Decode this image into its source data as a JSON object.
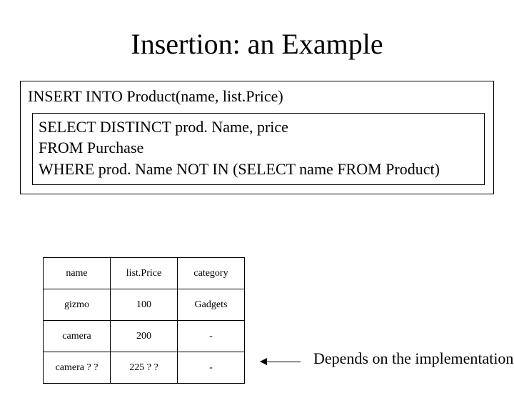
{
  "title": "Insertion: an Example",
  "sql": {
    "outer": "INSERT   INTO   Product(name, list.Price)",
    "inner_line1": "SELECT  DISTINCT  prod. Name, price",
    "inner_line2": "FROM  Purchase",
    "inner_line3": "WHERE   prod. Name  NOT IN (SELECT  name FROM  Product)"
  },
  "table": {
    "headers": [
      "name",
      "list.Price",
      "category"
    ],
    "rows": [
      [
        "gizmo",
        "100",
        "Gadgets"
      ],
      [
        "camera",
        "200",
        "-"
      ],
      [
        "camera ? ?",
        "225 ? ?",
        "-"
      ]
    ]
  },
  "note": "Depends on the implementation"
}
